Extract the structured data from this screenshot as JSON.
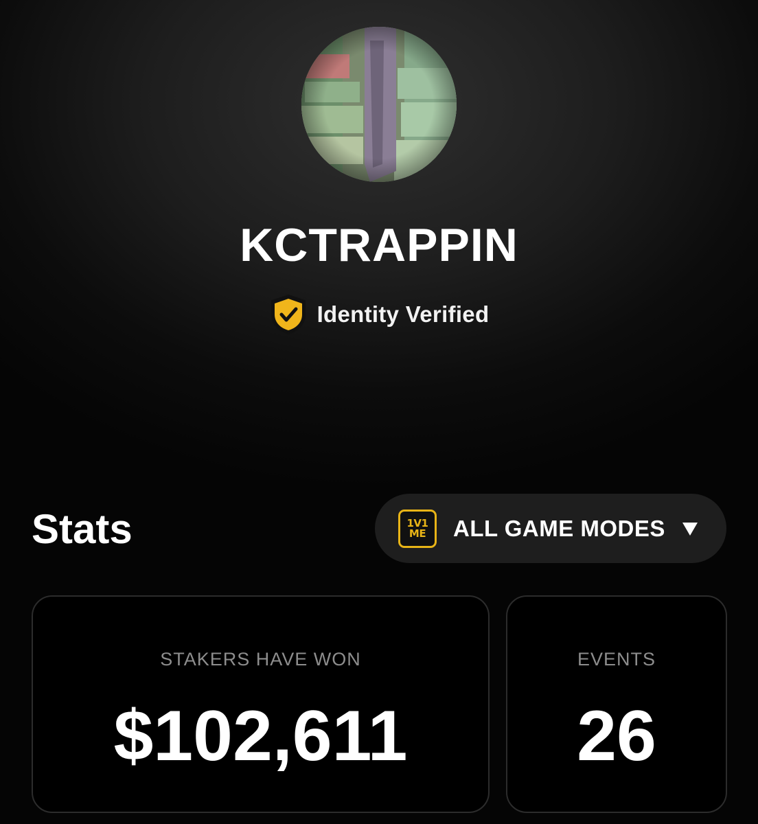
{
  "profile": {
    "username": "KCTRAPPIN",
    "verification_label": "Identity Verified",
    "avatar_icon": "money-stack-photo"
  },
  "stats": {
    "heading": "Stats",
    "mode_selector": {
      "logo_top": "1V1",
      "logo_bottom": "ME",
      "label": "ALL GAME MODES",
      "icon": "chevron-down-icon"
    },
    "cards": [
      {
        "label": "STAKERS HAVE WON",
        "value": "$102,611"
      },
      {
        "label": "EVENTS",
        "value": "26"
      }
    ]
  },
  "colors": {
    "accent": "#e8b417",
    "background": "#000000",
    "card_border": "#2c2c2c",
    "selector_bg": "#1e1e1e",
    "muted_text": "#8d8d8d"
  }
}
